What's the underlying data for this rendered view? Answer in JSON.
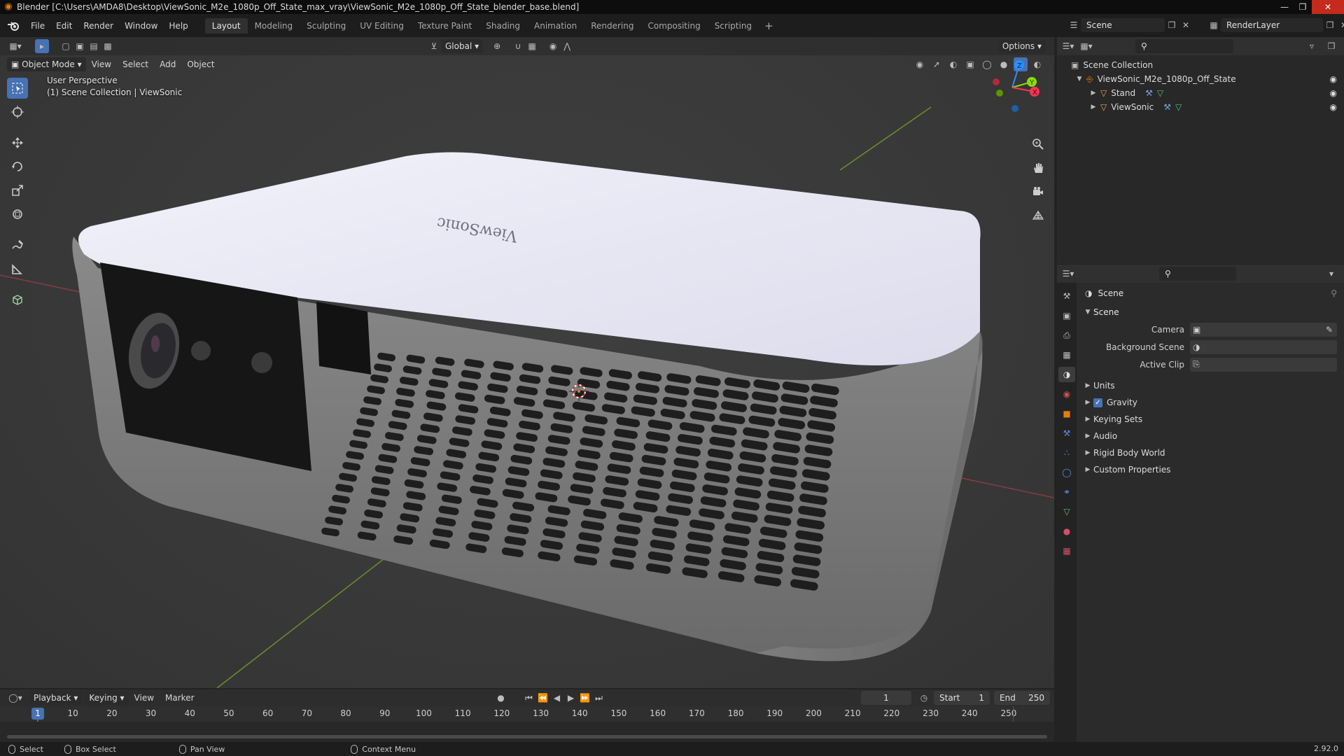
{
  "window": {
    "title": "Blender [C:\\Users\\AMDA8\\Desktop\\ViewSonic_M2e_1080p_Off_State_max_vray\\ViewSonic_M2e_1080p_Off_State_blender_base.blend]",
    "controls": [
      "minimize-icon",
      "maximize-icon",
      "close-icon"
    ]
  },
  "menubar": {
    "items": [
      "File",
      "Edit",
      "Render",
      "Window",
      "Help"
    ],
    "workspaces": [
      "Layout",
      "Modeling",
      "Sculpting",
      "UV Editing",
      "Texture Paint",
      "Shading",
      "Animation",
      "Rendering",
      "Compositing",
      "Scripting"
    ],
    "active_workspace": "Layout",
    "add_workspace": "+",
    "scene_name": "Scene",
    "view_layer": "RenderLayer"
  },
  "viewport": {
    "mode": "Object Mode",
    "menus": [
      "View",
      "Select",
      "Add",
      "Object"
    ],
    "transform_orientation": "Global",
    "options_label": "Options",
    "overlay_title": "User Perspective",
    "overlay_subtitle": "(1) Scene Collection | ViewSonic",
    "model_logo_text": "ViewSonic",
    "gizmo_axes": [
      "Z",
      "Y",
      "X"
    ]
  },
  "toolbar": {
    "tools": [
      "select-box-icon",
      "cursor-icon",
      "move-icon",
      "rotate-icon",
      "scale-icon",
      "transform-icon",
      "annotate-icon",
      "measure-icon",
      "add-cube-icon"
    ],
    "active": 0
  },
  "outliner": {
    "root": "Scene Collection",
    "items": [
      {
        "name": "ViewSonic_M2e_1080p_Off_State",
        "level": 1,
        "icon": "collection-icon"
      },
      {
        "name": "Stand",
        "level": 2,
        "icon": "mesh-object-icon"
      },
      {
        "name": "ViewSonic",
        "level": 2,
        "icon": "mesh-object-icon"
      }
    ]
  },
  "properties": {
    "context_title": "Scene",
    "panel": "Scene",
    "rows": [
      {
        "label": "Camera",
        "value": ""
      },
      {
        "label": "Background Scene",
        "value": ""
      },
      {
        "label": "Active Clip",
        "value": ""
      }
    ],
    "subpanels": [
      "Units",
      "Gravity",
      "Keying Sets",
      "Audio",
      "Rigid Body World",
      "Custom Properties"
    ],
    "gravity_enabled": true
  },
  "timeline": {
    "menus": [
      "Playback",
      "Keying",
      "View",
      "Marker"
    ],
    "current_frame": "1",
    "start_label": "Start",
    "start": "1",
    "end_label": "End",
    "end": "250",
    "ticks": [
      "10",
      "20",
      "30",
      "40",
      "50",
      "60",
      "70",
      "80",
      "90",
      "100",
      "110",
      "120",
      "130",
      "140",
      "150",
      "160",
      "170",
      "180",
      "190",
      "200",
      "210",
      "220",
      "230",
      "240",
      "250"
    ],
    "playhead_label": "1"
  },
  "statusbar": {
    "select": "Select",
    "box_select": "Box Select",
    "pan_view": "Pan View",
    "context_menu": "Context Menu",
    "version": "2.92.0"
  },
  "colors": {
    "accent": "#4772b3",
    "x_axis": "#ff3352",
    "y_axis": "#8bdc00",
    "z_axis": "#2890ff",
    "blender_orange": "#e87d0d"
  }
}
